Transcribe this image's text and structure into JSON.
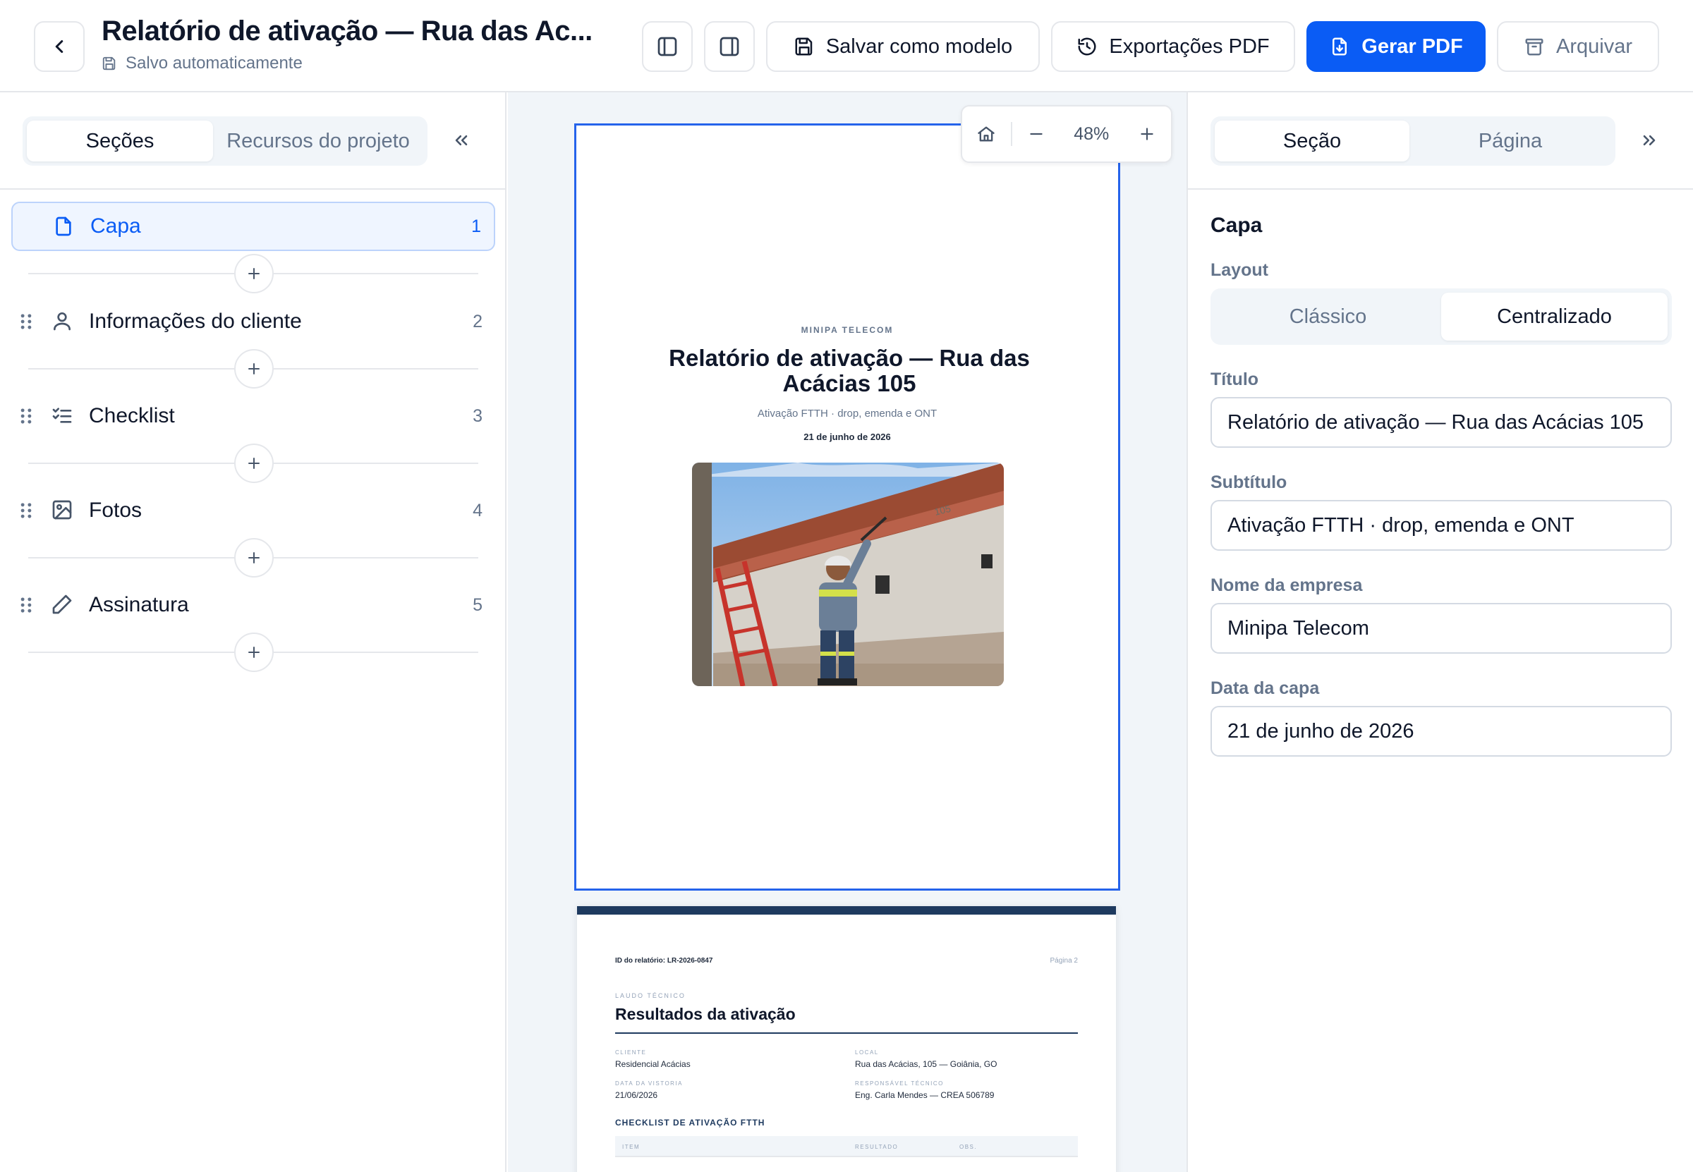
{
  "header": {
    "title": "Relatório de ativação — Rua das Ac...",
    "autosave": "Salvo automaticamente",
    "buttons": {
      "save_template": "Salvar como modelo",
      "pdf_exports": "Exportações PDF",
      "generate_pdf": "Gerar PDF",
      "archive": "Arquivar"
    }
  },
  "left_panel": {
    "tabs": [
      "Seções",
      "Recursos do projeto"
    ],
    "active_tab": "Seções",
    "sections": [
      {
        "label": "Capa",
        "number": "1",
        "icon": "file-icon",
        "active": true
      },
      {
        "label": "Informações do cliente",
        "number": "2",
        "icon": "user-icon"
      },
      {
        "label": "Checklist",
        "number": "3",
        "icon": "checklist-icon"
      },
      {
        "label": "Fotos",
        "number": "4",
        "icon": "image-icon"
      },
      {
        "label": "Assinatura",
        "number": "5",
        "icon": "pencil-icon"
      }
    ]
  },
  "canvas": {
    "zoom": "48%",
    "page1": {
      "company": "MINIPA TELECOM",
      "title": "Relatório de ativação — Rua das Acácias 105",
      "subtitle": "Ativação FTTH · drop, emenda e ONT",
      "date": "21 de junho de 2026"
    },
    "page2": {
      "report_id": "ID do relatório: LR-2026-0847",
      "page_label": "Página 2",
      "kicker": "LAUDO TÉCNICO",
      "heading": "Resultados da ativação",
      "client_label": "CLIENTE",
      "client": "Residencial Acácias",
      "location_label": "LOCAL",
      "location": "Rua das Acácias, 105 — Goiânia, GO",
      "inspection_label": "DATA DA VISTORIA",
      "inspection_date": "21/06/2026",
      "tech_label": "RESPONSÁVEL TÉCNICO",
      "tech": "Eng. Carla Mendes — CREA 506789",
      "checklist_heading": "CHECKLIST DE ATIVAÇÃO FTTH",
      "columns": [
        "ITEM",
        "RESULTADO",
        "OBS."
      ]
    }
  },
  "right_panel": {
    "tabs": [
      "Seção",
      "Página"
    ],
    "active_tab": "Seção",
    "section_title": "Capa",
    "layout_label": "Layout",
    "layout_options": [
      "Clássico",
      "Centralizado"
    ],
    "layout_selected": "Centralizado",
    "fields": {
      "title_label": "Título",
      "title_value": "Relatório de ativação — Rua das Acácias 105",
      "subtitle_label": "Subtítulo",
      "subtitle_value": "Ativação FTTH · drop, emenda e ONT",
      "company_label": "Nome da empresa",
      "company_value": "Minipa Telecom",
      "date_label": "Data da capa",
      "date_value": "21 de junho de 2026"
    }
  },
  "colors": {
    "accent": "#0a5cf5",
    "navy": "#1e3a5f",
    "border": "#e5e7eb",
    "muted": "#64748b"
  }
}
